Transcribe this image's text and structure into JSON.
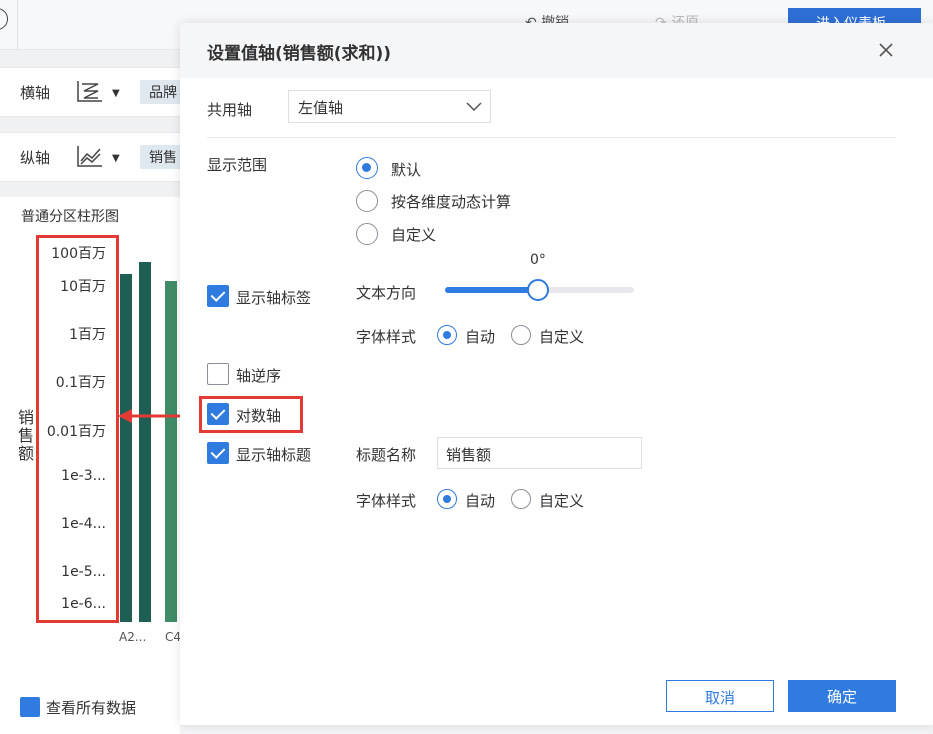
{
  "toolbar": {
    "undo_label": "撤销",
    "redo_label": "还原",
    "enter_dashboard_label": "进入仪表板"
  },
  "sidebar": {
    "x_axis_label": "横轴",
    "x_axis_chip": "品牌",
    "y_axis_label": "纵轴",
    "y_axis_chip": "销售"
  },
  "chart": {
    "title": "普通分区柱形图",
    "y_axis_title": "销售额",
    "y_ticks": [
      "100百万",
      "10百万",
      "1百万",
      "0.1百万",
      "0.01百万",
      "1e-3...",
      "1e-4...",
      "1e-5...",
      "1e-6..."
    ],
    "x_ticks": [
      "A2...",
      "C4"
    ],
    "view_all_label": "查看所有数据"
  },
  "chart_data": {
    "type": "bar",
    "title": "普通分区柱形图",
    "ylabel": "销售额",
    "yscale": "log",
    "y_tick_labels": [
      "100百万",
      "10百万",
      "1百万",
      "0.1百万",
      "0.01百万",
      "1e-3...",
      "1e-4...",
      "1e-5...",
      "1e-6..."
    ],
    "ylim_exponent": [
      -6,
      8
    ],
    "categories": [
      "A2...",
      "C4"
    ],
    "series": [
      {
        "color": "#1f5e52",
        "values_log10": [
          7.25,
          7.5
        ]
      },
      {
        "color": "#3f8c67",
        "values_log10": [
          7.1,
          null
        ]
      }
    ]
  },
  "dialog": {
    "title": "设置值轴(销售额(求和))",
    "shared_axis_label": "共用轴",
    "shared_axis_value": "左值轴",
    "range_label": "显示范围",
    "range_options": [
      "默认",
      "按各维度动态计算",
      "自定义"
    ],
    "range_selected": "默认",
    "show_axis_tags_label": "显示轴标签",
    "show_axis_tags_checked": true,
    "text_direction_label": "文本方向",
    "text_direction_value": "0°",
    "text_direction_degrees": 0,
    "font_style_label": "字体样式",
    "font_auto_label": "自动",
    "font_custom_label": "自定义",
    "reverse_axis_label": "轴逆序",
    "reverse_axis_checked": false,
    "log_axis_label": "对数轴",
    "log_axis_checked": true,
    "show_axis_title_label": "显示轴标题",
    "show_axis_title_checked": true,
    "title_name_label": "标题名称",
    "title_name_value": "销售额",
    "title_font_style_label": "字体样式",
    "title_font_auto_label": "自动",
    "title_font_custom_label": "自定义",
    "cancel_label": "取消",
    "ok_label": "确定"
  },
  "colors": {
    "accent": "#2f7be0",
    "annotation": "#e53935",
    "bar_dark": "#1f5e52",
    "bar_green": "#3f8c67"
  }
}
